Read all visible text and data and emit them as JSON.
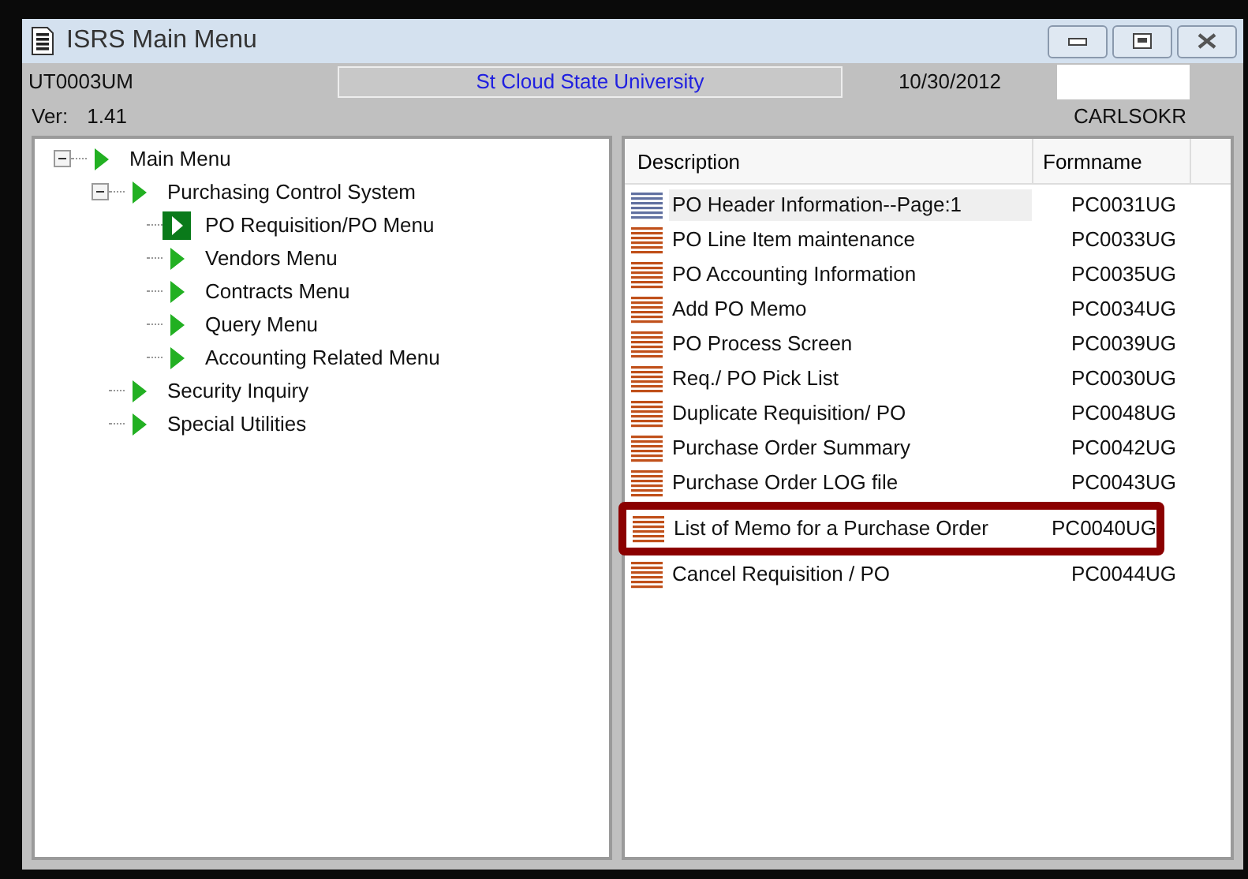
{
  "window": {
    "title": "ISRS Main Menu"
  },
  "header": {
    "form_id": "UT0003UM",
    "institution": "St Cloud State University",
    "date": "10/30/2012",
    "version_label": "Ver:",
    "version": "1.41",
    "user": "CARLSOKR"
  },
  "tree": [
    {
      "label": "Main Menu",
      "expanded": true,
      "selected": false,
      "children": [
        {
          "label": "Purchasing Control System",
          "expanded": true,
          "selected": false,
          "children": [
            {
              "label": "PO Requisition/PO Menu",
              "selected": true
            },
            {
              "label": "Vendors Menu",
              "selected": false
            },
            {
              "label": "Contracts Menu",
              "selected": false
            },
            {
              "label": "Query Menu",
              "selected": false
            },
            {
              "label": "Accounting Related Menu",
              "selected": false
            }
          ]
        },
        {
          "label": "Security Inquiry",
          "selected": false
        },
        {
          "label": "Special Utilities",
          "selected": false
        }
      ]
    }
  ],
  "table": {
    "columns": [
      "Description",
      "Formname"
    ],
    "rows": [
      {
        "description": "PO Header Information--Page:1",
        "formname": "PC0031UG",
        "selected": true
      },
      {
        "description": "PO Line Item maintenance",
        "formname": "PC0033UG",
        "selected": false
      },
      {
        "description": "PO Accounting Information",
        "formname": "PC0035UG",
        "selected": false
      },
      {
        "description": "Add PO Memo",
        "formname": "PC0034UG",
        "selected": false
      },
      {
        "description": "PO Process Screen",
        "formname": "PC0039UG",
        "selected": false
      },
      {
        "description": "Req./ PO Pick List",
        "formname": "PC0030UG",
        "selected": false
      },
      {
        "description": "Duplicate Requisition/ PO",
        "formname": "PC0048UG",
        "selected": false
      },
      {
        "description": "Purchase Order Summary",
        "formname": "PC0042UG",
        "selected": false
      },
      {
        "description": "Purchase Order LOG file",
        "formname": "PC0043UG",
        "selected": false
      },
      {
        "description": "List of Memo for a Purchase Order",
        "formname": "PC0040UG",
        "selected": false,
        "highlighted": true
      },
      {
        "description": "Cancel Requisition / PO",
        "formname": "PC0044UG",
        "selected": false
      }
    ]
  }
}
